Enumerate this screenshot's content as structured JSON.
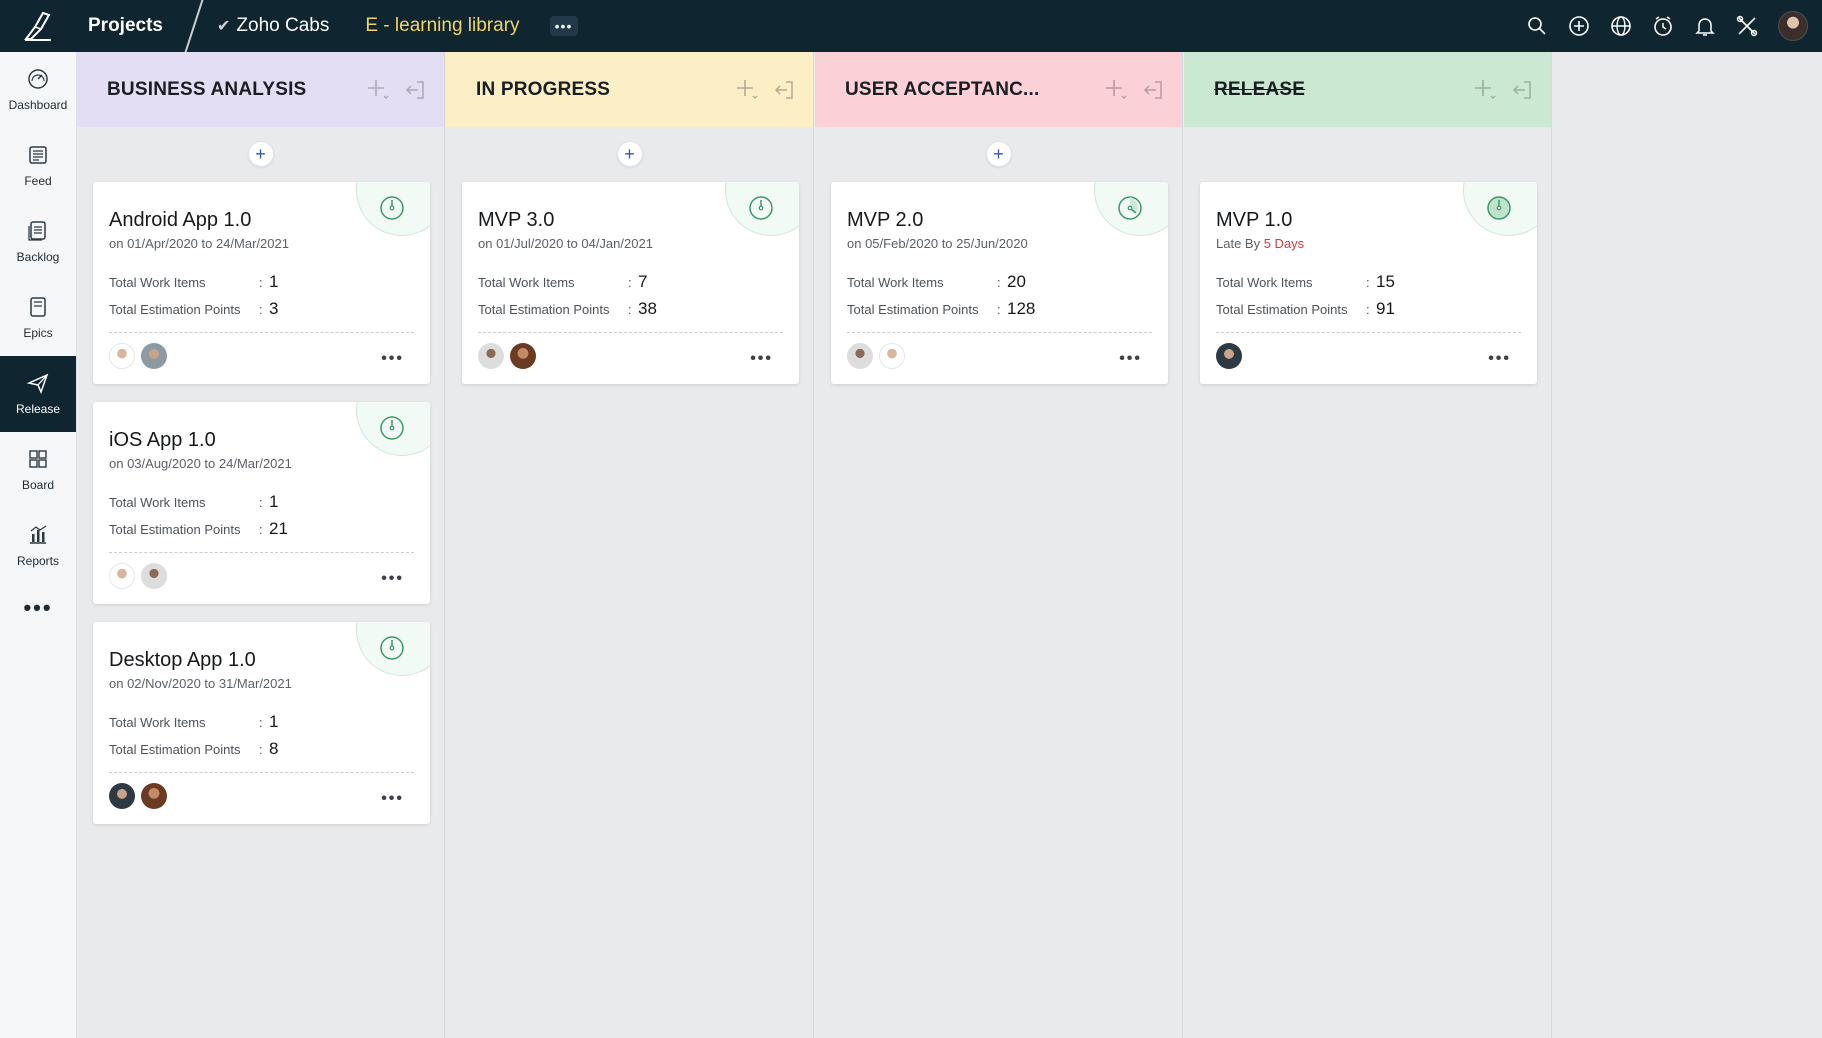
{
  "topbar": {
    "projects_label": "Projects",
    "project_name": "Zoho Cabs",
    "library_name": "E - learning library",
    "more_label": "•••"
  },
  "sidebar": {
    "items": [
      {
        "label": "Dashboard"
      },
      {
        "label": "Feed"
      },
      {
        "label": "Backlog"
      },
      {
        "label": "Epics"
      },
      {
        "label": "Release"
      },
      {
        "label": "Board"
      },
      {
        "label": "Reports"
      }
    ],
    "more_label": "•••"
  },
  "columns": [
    {
      "title": "BUSINESS ANALYSIS",
      "color": "#e4def4",
      "cards": [
        {
          "title": "Android App 1.0",
          "subtitle": "on 01/Apr/2020 to 24/Mar/2021",
          "work_items_label": "Total Work Items",
          "work_items": "1",
          "points_label": "Total Estimation Points",
          "points": "3"
        },
        {
          "title": "iOS App 1.0",
          "subtitle": "on 03/Aug/2020 to 24/Mar/2021",
          "work_items_label": "Total Work Items",
          "work_items": "1",
          "points_label": "Total Estimation Points",
          "points": "21"
        },
        {
          "title": "Desktop App 1.0",
          "subtitle": "on 02/Nov/2020 to 31/Mar/2021",
          "work_items_label": "Total Work Items",
          "work_items": "1",
          "points_label": "Total Estimation Points",
          "points": "8"
        }
      ]
    },
    {
      "title": "IN PROGRESS",
      "color": "#fcefc6",
      "cards": [
        {
          "title": "MVP 3.0",
          "subtitle": "on 01/Jul/2020 to 04/Jan/2021",
          "work_items_label": "Total Work Items",
          "work_items": "7",
          "points_label": "Total Estimation Points",
          "points": "38"
        }
      ]
    },
    {
      "title": "USER ACCEPTANC...",
      "color": "#fbd1d7",
      "cards": [
        {
          "title": "MVP 2.0",
          "subtitle": "on 05/Feb/2020 to 25/Jun/2020",
          "work_items_label": "Total Work Items",
          "work_items": "20",
          "points_label": "Total Estimation Points",
          "points": "128"
        }
      ]
    },
    {
      "title": "RELEASE",
      "color": "#cbe8d2",
      "cards": [
        {
          "title": "MVP 1.0",
          "late_prefix": "Late By",
          "late_value": "5 Days",
          "work_items_label": "Total Work Items",
          "work_items": "15",
          "points_label": "Total Estimation Points",
          "points": "91"
        }
      ]
    }
  ],
  "card_more_label": "•••",
  "add_label": "+"
}
